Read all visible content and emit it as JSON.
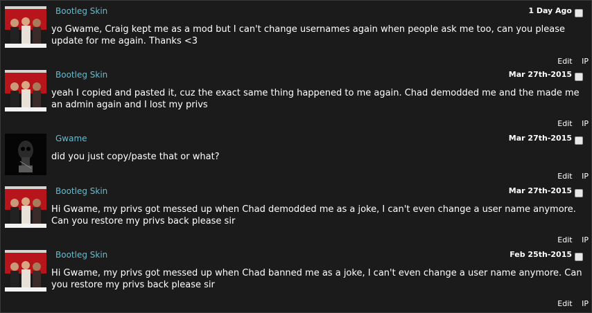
{
  "posts": [
    {
      "author": "Bootleg Skin",
      "date": "1 Day Ago",
      "message": "yo Gwame, Craig kept me as a mod but I can't change usernames again when people ask me too, can you please update for me again. Thanks <3",
      "actions": [
        "Edit",
        "IP"
      ],
      "avatar": "group-photo"
    },
    {
      "author": "Bootleg Skin",
      "date": "Mar 27th-2015",
      "message": "yeah I copied and pasted it, cuz the exact same thing happened to me again. Chad demodded me and the made me an admin again and I lost my privs",
      "actions": [
        "Edit",
        "IP"
      ],
      "avatar": "group-photo"
    },
    {
      "author": "Gwame",
      "date": "Mar 27th-2015",
      "message": "did you just copy/paste that or what?",
      "actions": [
        "Edit",
        "IP"
      ],
      "avatar": "dark-skull"
    },
    {
      "author": "Bootleg Skin",
      "date": "Mar 27th-2015",
      "message": "Hi Gwame, my privs got messed up when Chad demodded me as a joke, I can't even change a user name anymore. Can you restore my privs back please sir",
      "actions": [
        "Edit",
        "IP"
      ],
      "avatar": "group-photo"
    },
    {
      "author": "Bootleg Skin",
      "date": "Feb 25th-2015",
      "message": "Hi Gwame, my privs got messed up when Chad banned me as a joke, I can't even change a user name anymore. Can you restore my privs back please sir",
      "actions": [
        "Edit",
        "IP"
      ],
      "avatar": "group-photo"
    }
  ]
}
